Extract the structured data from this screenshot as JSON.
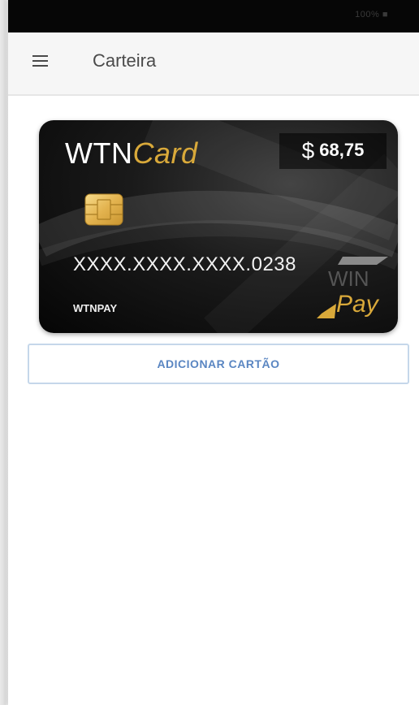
{
  "status_bar": {
    "text": "100% ■"
  },
  "app_bar": {
    "title": "Carteira",
    "menu_icon": "hamburger-menu-icon"
  },
  "card": {
    "brand_main": "WTN",
    "brand_accent": "Card",
    "currency": "$",
    "balance": "68,75",
    "number": "XXXX.XXXX.XXXX.0238",
    "holder": "WTNPAY",
    "logo_top": "WIN",
    "logo_bottom": "Pay",
    "chip_icon": "chip-icon",
    "colors": {
      "accent": "#d9a93a",
      "card_bg": "#0b0b0b"
    }
  },
  "actions": {
    "add_card": "ADICIONAR CARTÃO"
  },
  "colors": {
    "link_blue": "#5a86c2",
    "button_border": "#c5d7ea"
  }
}
